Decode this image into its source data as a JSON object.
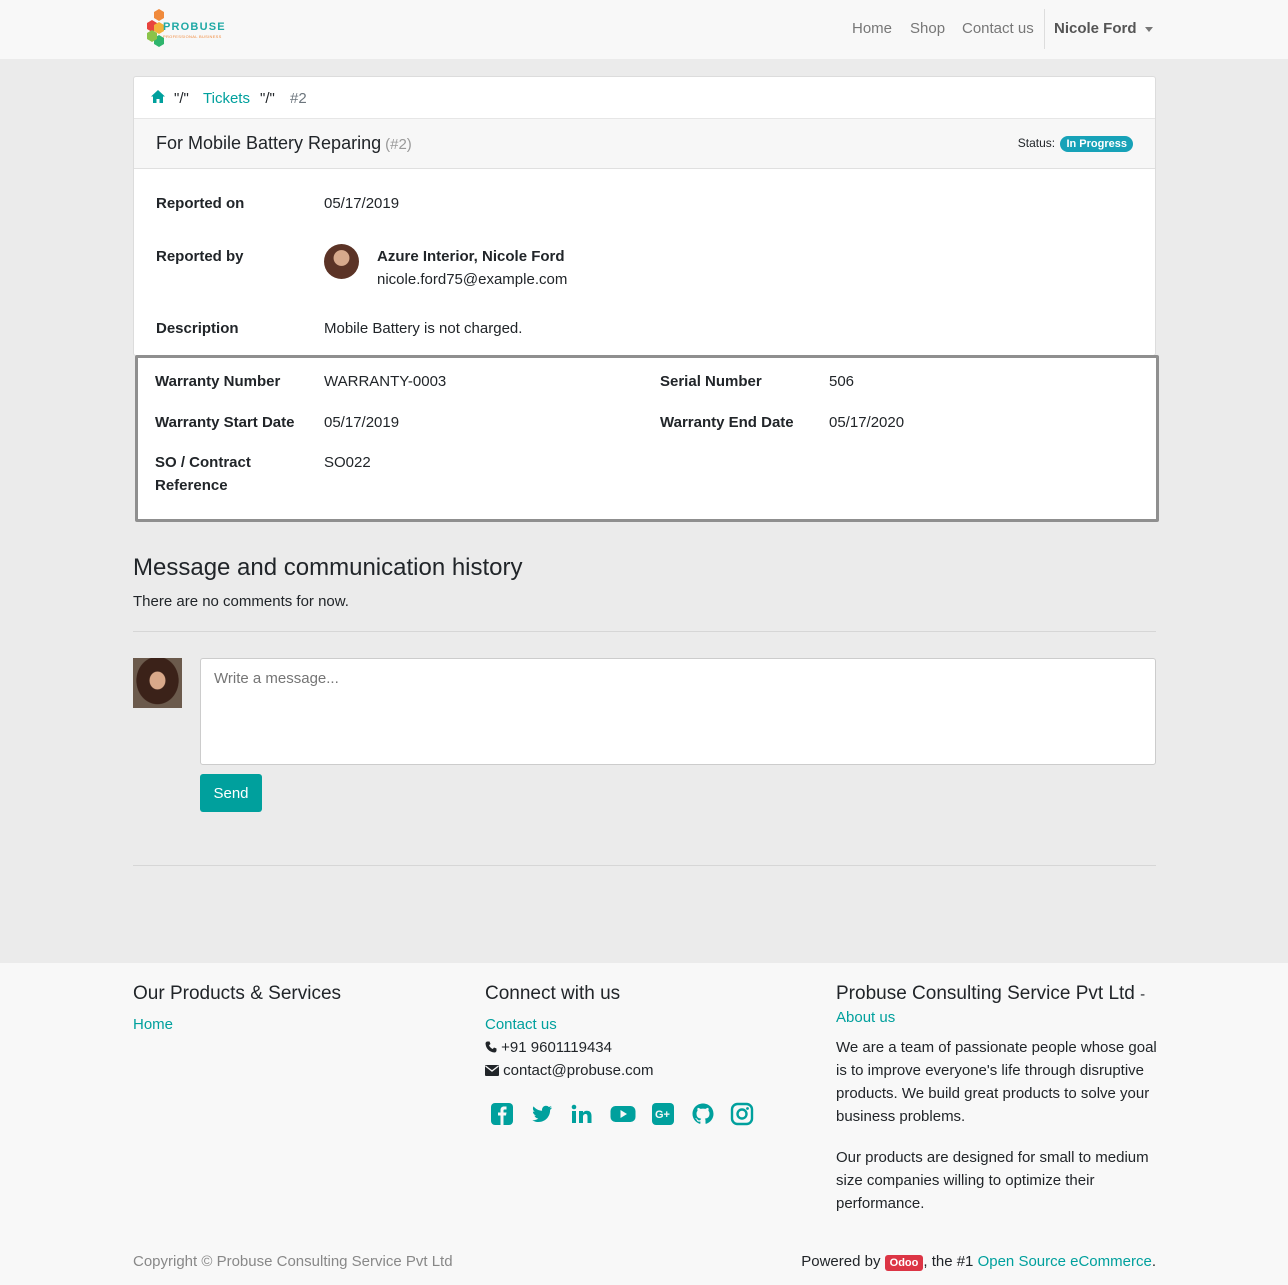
{
  "navbar": {
    "logo_text": "PROBUSE",
    "logo_sub": "PROFESSIONAL BUSINESS",
    "links": [
      "Home",
      "Shop",
      "Contact us"
    ],
    "user": "Nicole Ford"
  },
  "breadcrumb": {
    "sep": "\"/\"",
    "tickets": "Tickets",
    "current": "#2"
  },
  "ticket": {
    "title": "For Mobile Battery Reparing",
    "number": "(#2)",
    "status_label": "Status:",
    "status": "In Progress",
    "reported_on_label": "Reported on",
    "reported_on": "05/17/2019",
    "reported_by_label": "Reported by",
    "reported_by_name": "Azure Interior, Nicole Ford",
    "reported_by_email": "nicole.ford75@example.com",
    "description_label": "Description",
    "description": "Mobile Battery is not charged."
  },
  "warranty": {
    "number_label": "Warranty Number",
    "number": "WARRANTY-0003",
    "serial_label": "Serial Number",
    "serial": "506",
    "start_label": "Warranty Start Date",
    "start": "05/17/2019",
    "end_label": "Warranty End Date",
    "end": "05/17/2020",
    "so_label_1": "SO / Contract",
    "so_label_2": "Reference",
    "so": "SO022"
  },
  "messages": {
    "heading": "Message and communication history",
    "empty": "There are no comments for now.",
    "placeholder": "Write a message...",
    "send": "Send"
  },
  "footer": {
    "col1_heading": "Our Products & Services",
    "col1_link": "Home",
    "col2_heading": "Connect with us",
    "contact_link": "Contact us",
    "phone": "+91 9601119434",
    "email": "contact@probuse.com",
    "col3_heading": "Probuse Consulting Service Pvt Ltd",
    "col3_dash": "-",
    "about_link": "About us",
    "para1": "We are a team of passionate people whose goal is to improve everyone's life through disruptive products. We build great products to solve your business problems.",
    "para2": "Our products are designed for small to medium size companies willing to optimize their performance.",
    "copyright": "Copyright © Probuse Consulting Service Pvt Ltd",
    "powered_prefix": "Powered by",
    "odoo": "Odoo",
    "powered_mid": ", the #1",
    "powered_link": "Open Source eCommerce",
    "powered_suffix": ".",
    "social": [
      "facebook-icon",
      "twitter-icon",
      "linkedin-icon",
      "youtube-icon",
      "google-plus-icon",
      "github-icon",
      "instagram-icon"
    ]
  }
}
